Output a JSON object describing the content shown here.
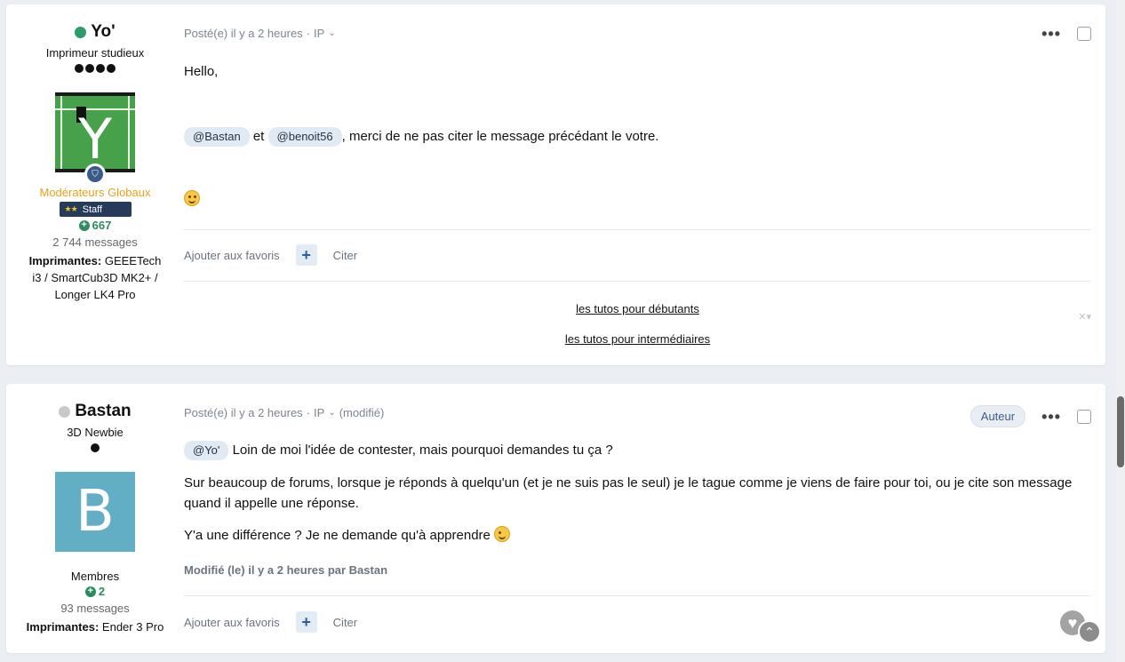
{
  "posts": [
    {
      "author": {
        "name": "Yo'",
        "status": "online",
        "rank_title": "Imprimeur studieux",
        "rank_pips": 4,
        "avatar_letter": "Y",
        "group": "Modérateurs Globaux",
        "staff_badge": "Staff",
        "reputation": "667",
        "post_count": "2 744 messages",
        "printers_label": "Imprimantes:",
        "printers_value": " GEEETech i3 / SmartCub3D MK2+ / Longer LK4 Pro"
      },
      "meta": {
        "posted": "Posté(e) il y a 2 heures",
        "sep": "·",
        "ip": "IP"
      },
      "body": {
        "greeting": "Hello,",
        "mention_1": "@Bastan",
        "connector": "et",
        "mention_2": "@benoit56",
        "text": ", merci de ne pas citer le message précédant le votre."
      },
      "footer": {
        "favorite": "Ajouter aux favoris",
        "plus": "+",
        "quote": "Citer"
      },
      "signature": {
        "link_1": "les tutos pour débutants",
        "link_2": "les tutos pour intermédiaires",
        "close": "✕▾"
      }
    },
    {
      "author": {
        "name": "Bastan",
        "status": "offline",
        "rank_title": "3D Newbie",
        "rank_pips": 1,
        "avatar_letter": "B",
        "group": "Membres",
        "reputation": "2",
        "post_count": "93 messages",
        "printers_label": "Imprimantes:",
        "printers_value": " Ender 3 Pro"
      },
      "meta": {
        "posted": "Posté(e) il y a 2 heures",
        "sep": "·",
        "ip": "IP",
        "modified": "(modifié)"
      },
      "author_pill": "Auteur",
      "body": {
        "mention": "@Yo'",
        "line_1": "Loin de moi l'idée de contester, mais pourquoi demandes tu ça ?",
        "line_2": "Sur beaucoup de forums, lorsque je réponds à quelqu'un (et je ne suis pas le seul) je le tague comme je viens de faire pour toi, ou je cite son message quand il appelle une réponse.",
        "line_3": "Y'a une différence ? Je ne demande qu'à apprendre"
      },
      "edited_note": "Modifié (le) il y a 2 heures par Bastan",
      "footer": {
        "favorite": "Ajouter aux favoris",
        "plus": "+",
        "quote": "Citer"
      }
    }
  ],
  "icons": {
    "more": "•••",
    "chevron": "⌄",
    "shield": "⛉",
    "heart": "♥",
    "arrow_up": "⌃",
    "rep_plus": "+"
  },
  "colors": {
    "online": "#2c9c6a",
    "moderator_group": "#e8a21a",
    "reputation": "#2c8c5f",
    "staff_badge_bg": "#263b5a"
  }
}
